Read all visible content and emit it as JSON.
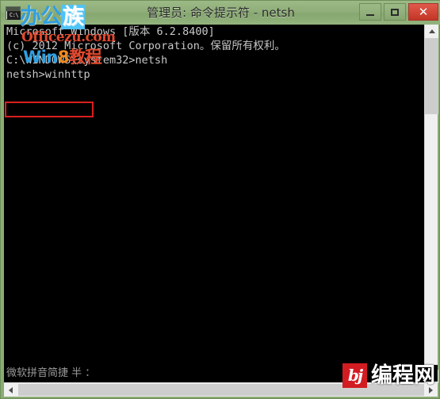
{
  "window": {
    "title": "管理员: 命令提示符 - netsh",
    "app_icon_label": "C:\\",
    "icon_name": "console-icon",
    "accent_titlebar": "#8fae79",
    "close_button_color": "#c33526",
    "console_bg": "#000000",
    "console_fg": "#c8c8c8"
  },
  "controls": {
    "minimize_label": "─",
    "maximize_label": "□",
    "close_label": "✕"
  },
  "console": {
    "lines": [
      "Microsoft Windows [版本 6.2.8400]",
      "(c) 2012 Microsoft Corporation。保留所有权利。",
      "",
      "C:\\WINDOWS\\system32>netsh",
      "",
      "netsh>winhttp"
    ],
    "highlight": {
      "text": "netsh>winhttp",
      "box_color": "#d81f1f"
    }
  },
  "ime": {
    "status_text": "微软拼音简捷 半 ："
  },
  "scrollbars": {
    "vertical": {
      "up_arrow": "▲",
      "down_arrow": "▼"
    },
    "horizontal": {
      "left_arrow": "◄",
      "right_arrow": "►"
    }
  },
  "watermark_officezu": {
    "line1_a": "办公",
    "line1_b": "族",
    "line2": "Officezu.com",
    "line3_a": "Win",
    "line3_b": "8",
    "line3_c": "教程"
  },
  "watermark_bcw": {
    "mark_glyph": "bj",
    "text": "编程网",
    "mark_color": "#d31b22"
  }
}
